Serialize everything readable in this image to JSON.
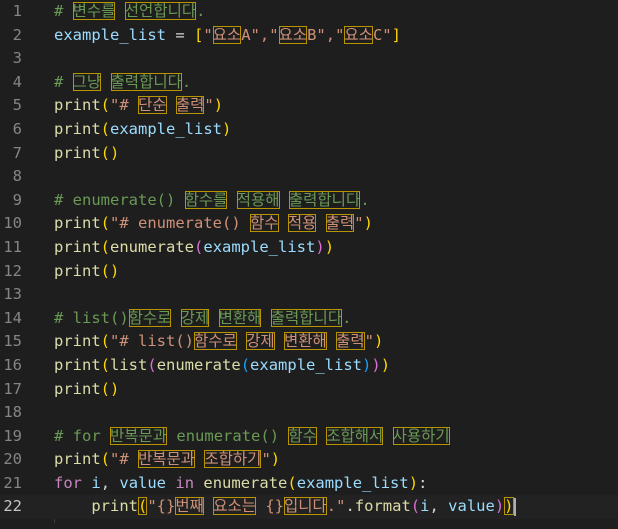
{
  "colors": {
    "background": "#1e1e1e",
    "line_number": "#858585",
    "comment": "#6a9955",
    "string": "#ce9178",
    "function": "#dcdcaa",
    "variable": "#9cdcfe",
    "keyword": "#c586c0",
    "bracket_gold": "#ffd700",
    "bracket_purple": "#da70d6",
    "bracket_blue": "#179fff",
    "unicode_highlight_border": "#b89500"
  },
  "editor": {
    "current_line": 22,
    "lines": [
      {
        "num": "1",
        "tokens": [
          [
            "comment",
            "# "
          ],
          [
            "comment",
            "변수를",
            true
          ],
          [
            "comment",
            " "
          ],
          [
            "comment",
            "선언합니다",
            true
          ],
          [
            "comment",
            "."
          ]
        ]
      },
      {
        "num": "2",
        "tokens": [
          [
            "var",
            "example_list"
          ],
          [
            "plain",
            " = "
          ],
          [
            "p1",
            "["
          ],
          [
            "string",
            "\""
          ],
          [
            "string",
            "요소",
            true
          ],
          [
            "string",
            "A\","
          ],
          [
            "string",
            "\""
          ],
          [
            "string",
            "요소",
            true
          ],
          [
            "string",
            "B\","
          ],
          [
            "string",
            "\""
          ],
          [
            "string",
            "요소",
            true
          ],
          [
            "string",
            "C\""
          ],
          [
            "p1",
            "]"
          ]
        ]
      },
      {
        "num": "3",
        "tokens": []
      },
      {
        "num": "4",
        "tokens": [
          [
            "comment",
            "# "
          ],
          [
            "comment",
            "그냥",
            true
          ],
          [
            "comment",
            " "
          ],
          [
            "comment",
            "출력합니다",
            true
          ],
          [
            "comment",
            "."
          ]
        ]
      },
      {
        "num": "5",
        "tokens": [
          [
            "fn",
            "print"
          ],
          [
            "p1",
            "("
          ],
          [
            "string",
            "\"# "
          ],
          [
            "string",
            "단순",
            true
          ],
          [
            "string",
            " "
          ],
          [
            "string",
            "출력",
            true
          ],
          [
            "string",
            "\""
          ],
          [
            "p1",
            ")"
          ]
        ]
      },
      {
        "num": "6",
        "tokens": [
          [
            "fn",
            "print"
          ],
          [
            "p1",
            "("
          ],
          [
            "var",
            "example_list"
          ],
          [
            "p1",
            ")"
          ]
        ]
      },
      {
        "num": "7",
        "tokens": [
          [
            "fn",
            "print"
          ],
          [
            "p1",
            "()"
          ]
        ]
      },
      {
        "num": "8",
        "tokens": []
      },
      {
        "num": "9",
        "tokens": [
          [
            "comment",
            "# enumerate() "
          ],
          [
            "comment",
            "함수를",
            true
          ],
          [
            "comment",
            " "
          ],
          [
            "comment",
            "적용해",
            true
          ],
          [
            "comment",
            " "
          ],
          [
            "comment",
            "출력합니다",
            true
          ],
          [
            "comment",
            "."
          ]
        ]
      },
      {
        "num": "10",
        "tokens": [
          [
            "fn",
            "print"
          ],
          [
            "p1",
            "("
          ],
          [
            "string",
            "\"# enumerate() "
          ],
          [
            "string",
            "함수",
            true
          ],
          [
            "string",
            " "
          ],
          [
            "string",
            "적용",
            true
          ],
          [
            "string",
            " "
          ],
          [
            "string",
            "출력",
            true
          ],
          [
            "string",
            "\""
          ],
          [
            "p1",
            ")"
          ]
        ]
      },
      {
        "num": "11",
        "tokens": [
          [
            "fn",
            "print"
          ],
          [
            "p1",
            "("
          ],
          [
            "fn",
            "enumerate"
          ],
          [
            "p2",
            "("
          ],
          [
            "var",
            "example_list"
          ],
          [
            "p2",
            ")"
          ],
          [
            "p1",
            ")"
          ]
        ]
      },
      {
        "num": "12",
        "tokens": [
          [
            "fn",
            "print"
          ],
          [
            "p1",
            "()"
          ]
        ]
      },
      {
        "num": "13",
        "tokens": []
      },
      {
        "num": "14",
        "tokens": [
          [
            "comment",
            "# list()"
          ],
          [
            "comment",
            "함수로",
            true
          ],
          [
            "comment",
            " "
          ],
          [
            "comment",
            "강제",
            true
          ],
          [
            "comment",
            " "
          ],
          [
            "comment",
            "변환해",
            true
          ],
          [
            "comment",
            " "
          ],
          [
            "comment",
            "출력합니다",
            true
          ],
          [
            "comment",
            "."
          ]
        ]
      },
      {
        "num": "15",
        "tokens": [
          [
            "fn",
            "print"
          ],
          [
            "p1",
            "("
          ],
          [
            "string",
            "\"# list()"
          ],
          [
            "string",
            "함수로",
            true
          ],
          [
            "string",
            " "
          ],
          [
            "string",
            "강제",
            true
          ],
          [
            "string",
            " "
          ],
          [
            "string",
            "변환해",
            true
          ],
          [
            "string",
            " "
          ],
          [
            "string",
            "출력",
            true
          ],
          [
            "string",
            "\""
          ],
          [
            "p1",
            ")"
          ]
        ]
      },
      {
        "num": "16",
        "tokens": [
          [
            "fn",
            "print"
          ],
          [
            "p1",
            "("
          ],
          [
            "fn",
            "list"
          ],
          [
            "p2",
            "("
          ],
          [
            "fn",
            "enumerate"
          ],
          [
            "p3",
            "("
          ],
          [
            "var",
            "example_list"
          ],
          [
            "p3",
            ")"
          ],
          [
            "p2",
            ")"
          ],
          [
            "p1",
            ")"
          ]
        ]
      },
      {
        "num": "17",
        "tokens": [
          [
            "fn",
            "print"
          ],
          [
            "p1",
            "()"
          ]
        ]
      },
      {
        "num": "18",
        "tokens": []
      },
      {
        "num": "19",
        "tokens": [
          [
            "comment",
            "# for "
          ],
          [
            "comment",
            "반복문과",
            true
          ],
          [
            "comment",
            " enumerate() "
          ],
          [
            "comment",
            "함수",
            true
          ],
          [
            "comment",
            " "
          ],
          [
            "comment",
            "조합해서",
            true
          ],
          [
            "comment",
            " "
          ],
          [
            "comment",
            "사용하기",
            true
          ]
        ]
      },
      {
        "num": "20",
        "tokens": [
          [
            "fn",
            "print"
          ],
          [
            "p1",
            "("
          ],
          [
            "string",
            "\"# "
          ],
          [
            "string",
            "반복문과",
            true
          ],
          [
            "string",
            " "
          ],
          [
            "string",
            "조합하기",
            true
          ],
          [
            "string",
            "\""
          ],
          [
            "p1",
            ")"
          ]
        ]
      },
      {
        "num": "21",
        "tokens": [
          [
            "kw",
            "for"
          ],
          [
            "plain",
            " "
          ],
          [
            "var",
            "i"
          ],
          [
            "plain",
            ", "
          ],
          [
            "var",
            "value"
          ],
          [
            "plain",
            " "
          ],
          [
            "kw",
            "in"
          ],
          [
            "plain",
            " "
          ],
          [
            "fn",
            "enumerate"
          ],
          [
            "p1",
            "("
          ],
          [
            "var",
            "example_list"
          ],
          [
            "p1",
            ")"
          ],
          [
            "plain",
            ":"
          ]
        ]
      },
      {
        "num": "22",
        "tokens": [
          [
            "plain",
            "    "
          ],
          [
            "fn",
            "print"
          ],
          [
            "p1",
            "(",
            true
          ],
          [
            "string",
            "\"{}"
          ],
          [
            "string",
            "번째",
            true
          ],
          [
            "string",
            " "
          ],
          [
            "string",
            "요소는",
            true
          ],
          [
            "string",
            " {}"
          ],
          [
            "string",
            "입니다",
            true
          ],
          [
            "string",
            ".\""
          ],
          [
            "plain",
            "."
          ],
          [
            "fn",
            "format"
          ],
          [
            "p2",
            "("
          ],
          [
            "var",
            "i"
          ],
          [
            "plain",
            ", "
          ],
          [
            "var",
            "value"
          ],
          [
            "p2",
            ")"
          ],
          [
            "p1",
            ")",
            true
          ]
        ]
      }
    ]
  }
}
